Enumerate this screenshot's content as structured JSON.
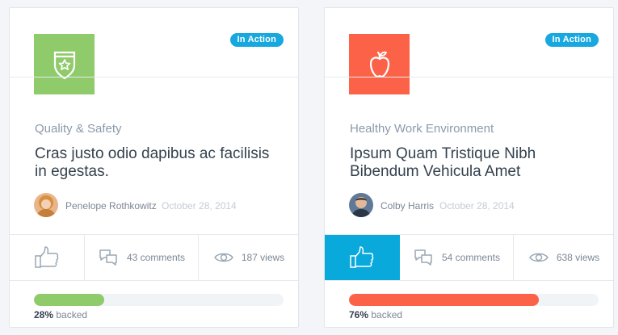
{
  "cards": [
    {
      "status": "In Action",
      "category": "Quality & Safety",
      "title": "Cras justo odio dapibus ac facilisis in egestas.",
      "author": "Penelope Rothkowitz",
      "date": "October 28, 2014",
      "comments": "43 comments",
      "views": "187 views",
      "backed_percent": "28%",
      "backed_label": "backed",
      "backed_fraction": 0.28,
      "icon": "shield-star-icon",
      "liked": false,
      "colors": {
        "tile": "#8fcb6a",
        "progress": "#8fcb6a",
        "badge": "#17a8e0"
      }
    },
    {
      "status": "In Action",
      "category": "Healthy Work Environment",
      "title": "Ipsum Quam Tristique Nibh Bibendum Vehicula Amet",
      "author": "Colby Harris",
      "date": "October 28, 2014",
      "comments": "54 comments",
      "views": "638 views",
      "backed_percent": "76%",
      "backed_label": "backed",
      "backed_fraction": 0.76,
      "icon": "apple-icon",
      "liked": true,
      "colors": {
        "tile": "#fb6248",
        "progress": "#fb6248",
        "badge": "#17a8e0",
        "liked_bg": "#0aa9dc"
      }
    }
  ]
}
